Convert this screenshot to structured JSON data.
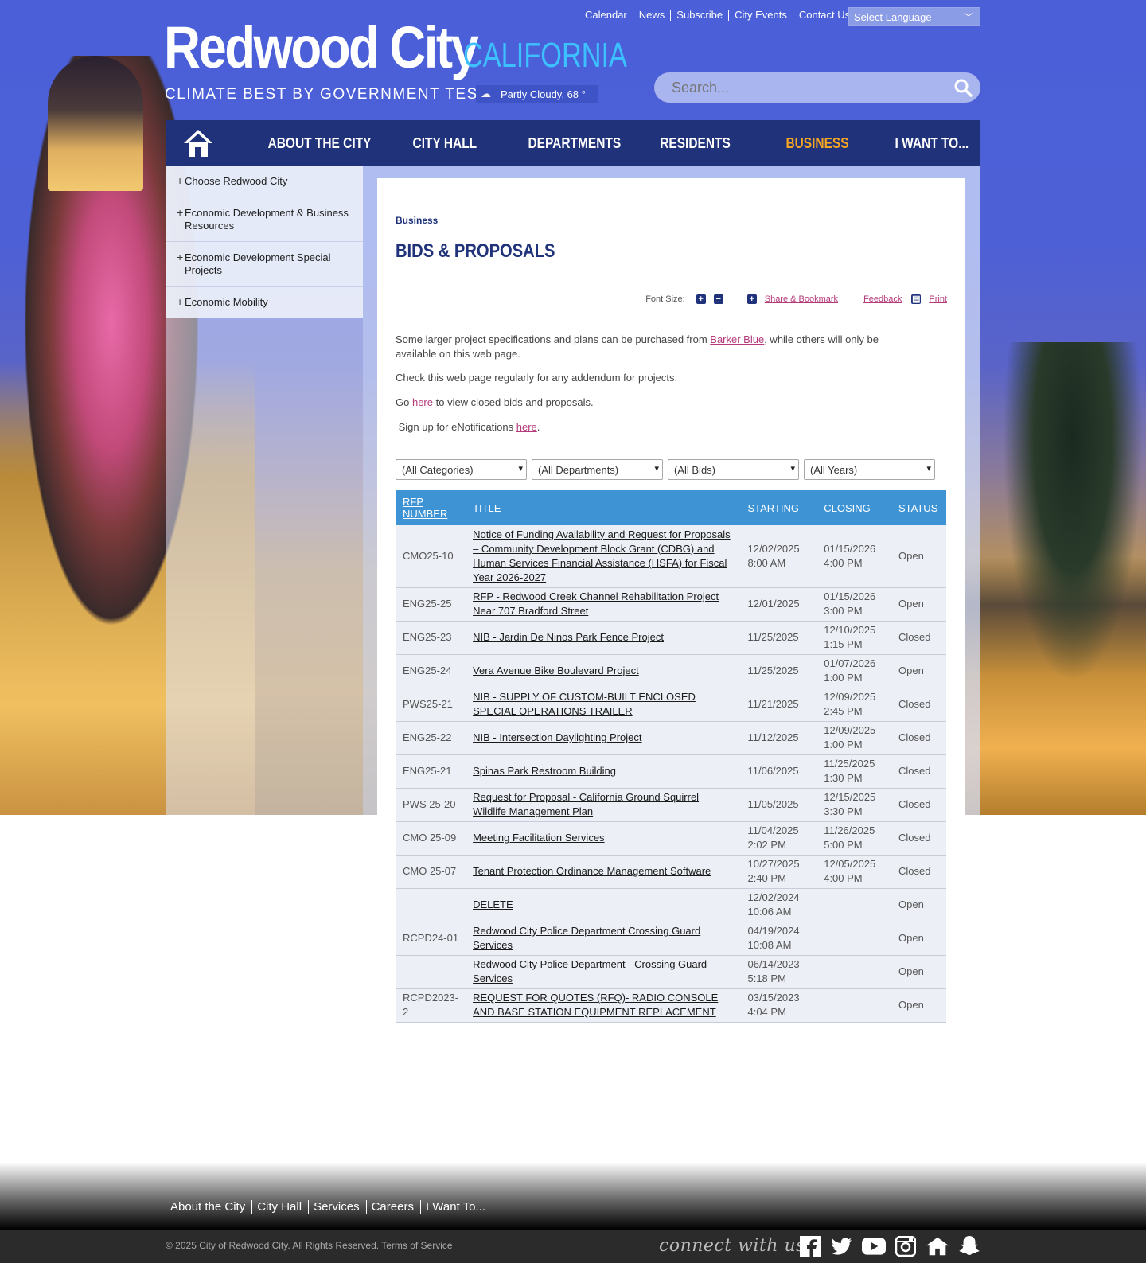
{
  "top_links": [
    "Calendar",
    "News",
    "Subscribe",
    "City Events",
    "Contact Us"
  ],
  "language": {
    "label": "Select Language"
  },
  "logo": {
    "main": "Redwood City",
    "state": "CALIFORNIA",
    "tagline": "CLIMATE BEST BY GOVERNMENT TEST"
  },
  "weather": {
    "text": "Partly Cloudy, 68 °"
  },
  "search": {
    "placeholder": "Search..."
  },
  "nav": {
    "items": [
      "ABOUT THE CITY",
      "CITY HALL",
      "DEPARTMENTS",
      "RESIDENTS",
      "BUSINESS",
      "I WANT TO..."
    ],
    "active": "BUSINESS"
  },
  "sidebar": {
    "items": [
      "Choose Redwood City",
      "Economic Development & Business Resources",
      "Economic Development Special Projects",
      "Economic Mobility"
    ]
  },
  "page": {
    "breadcrumb": "Business",
    "title": "BIDS & PROPOSALS",
    "tools": {
      "font_size": "Font Size:",
      "share": "Share & Bookmark",
      "feedback": "Feedback",
      "print": "Print"
    },
    "para1_before": "Some larger project specifications and plans can be purchased from ",
    "para1_link": "Barker Blue",
    "para1_after": ", while others will only be available on this web page.",
    "para2": "Check this web page regularly for any addendum for projects.",
    "para3_before": "Go ",
    "para3_link": "here",
    "para3_after": " to view closed bids and proposals.",
    "para4_before": " Sign up for eNotifications ",
    "para4_link": "here",
    "para4_after": "."
  },
  "filters": [
    "(All Categories)",
    "(All Departments)",
    "(All Bids)",
    "(All Years)"
  ],
  "table": {
    "headers": {
      "rfp": "RFP NUMBER",
      "title": "TITLE",
      "starting": "STARTING",
      "closing": "CLOSING",
      "status": "STATUS"
    },
    "rows": [
      {
        "rfp": "CMO25-10",
        "title": "Notice of Funding Availability and Request for Proposals – Community Development Block Grant (CDBG) and Human Services Financial Assistance (HSFA) for Fiscal Year 2026-2027",
        "starting": "12/02/2025 8:00 AM",
        "closing": "01/15/2026 4:00 PM",
        "status": "Open"
      },
      {
        "rfp": "ENG25-25",
        "title": "RFP - Redwood Creek Channel Rehabilitation Project Near 707 Bradford Street",
        "starting": "12/01/2025",
        "closing": "01/15/2026 3:00 PM",
        "status": "Open"
      },
      {
        "rfp": "ENG25-23",
        "title": "NIB - Jardin De Ninos Park Fence Project",
        "starting": "11/25/2025",
        "closing": "12/10/2025 1:15 PM",
        "status": "Closed"
      },
      {
        "rfp": "ENG25-24",
        "title": "Vera Avenue Bike Boulevard Project",
        "starting": "11/25/2025",
        "closing": "01/07/2026 1:00 PM",
        "status": "Open"
      },
      {
        "rfp": "PWS25-21",
        "title": "NIB - SUPPLY OF CUSTOM-BUILT ENCLOSED SPECIAL OPERATIONS TRAILER",
        "starting": "11/21/2025",
        "closing": "12/09/2025 2:45 PM",
        "status": "Closed"
      },
      {
        "rfp": "ENG25-22",
        "title": "NIB - Intersection Daylighting Project",
        "starting": "11/12/2025",
        "closing": "12/09/2025 1:00 PM",
        "status": "Closed"
      },
      {
        "rfp": "ENG25-21",
        "title": "Spinas Park Restroom Building",
        "starting": "11/06/2025",
        "closing": "11/25/2025 1:30 PM",
        "status": "Closed"
      },
      {
        "rfp": "PWS 25-20",
        "title": "Request for Proposal - California Ground Squirrel Wildlife Management Plan",
        "starting": "11/05/2025",
        "closing": "12/15/2025 3:30 PM",
        "status": "Closed"
      },
      {
        "rfp": "CMO 25-09",
        "title": "Meeting Facilitation Services",
        "starting": "11/04/2025 2:02 PM",
        "closing": "11/26/2025 5:00 PM",
        "status": "Closed"
      },
      {
        "rfp": "CMO 25-07",
        "title": "Tenant Protection Ordinance Management Software",
        "starting": "10/27/2025 2:40 PM",
        "closing": "12/05/2025 4:00 PM",
        "status": "Closed"
      },
      {
        "rfp": "",
        "title": "DELETE",
        "starting": "12/02/2024 10:06 AM",
        "closing": "",
        "status": "Open"
      },
      {
        "rfp": "RCPD24-01",
        "title": "Redwood City Police Department Crossing Guard Services",
        "starting": "04/19/2024 10:08 AM",
        "closing": "",
        "status": "Open"
      },
      {
        "rfp": "",
        "title": "Redwood City Police Department - Crossing Guard Services",
        "starting": "06/14/2023 5:18 PM",
        "closing": "",
        "status": "Open"
      },
      {
        "rfp": "RCPD2023-2",
        "title": "REQUEST FOR QUOTES (RFQ)- RADIO CONSOLE AND BASE STATION EQUIPMENT REPLACEMENT",
        "starting": "03/15/2023 4:04 PM",
        "closing": "",
        "status": "Open"
      }
    ]
  },
  "footer": {
    "links": [
      "About the City",
      "City Hall",
      "Services",
      "Careers",
      "I Want To..."
    ],
    "copyright": "© 2025 City of Redwood City. All Rights Reserved. Terms of Service",
    "connect": "connect with us",
    "socials": [
      "facebook-icon",
      "twitter-icon",
      "youtube-icon",
      "instagram-icon",
      "nextdoor-icon",
      "snapchat-icon"
    ]
  },
  "colors": {
    "brand_blue": "#1f327a",
    "sky_blue": "#4a5fd8",
    "accent_orange": "#f6a621",
    "link_pink": "#b43a7a",
    "table_header": "#3d93d3"
  }
}
